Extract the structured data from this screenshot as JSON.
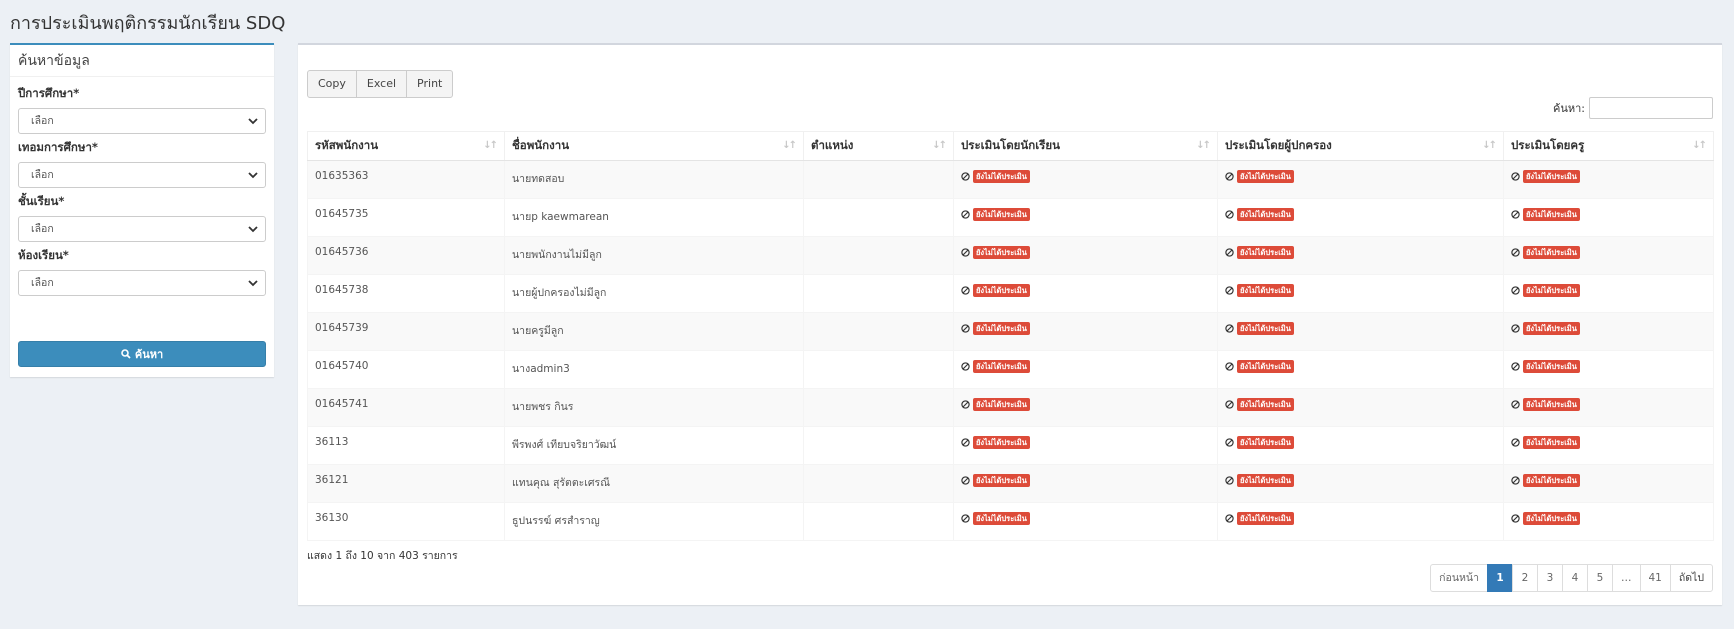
{
  "page": {
    "title": "การประเมินพฤติกรรมนักเรียน SDQ"
  },
  "search": {
    "title": "ค้นหาข้อมูล",
    "fields": [
      {
        "label": "ปีการศึกษา*",
        "value": "เลือก"
      },
      {
        "label": "เทอมการศึกษา*",
        "value": "เลือก"
      },
      {
        "label": "ชั้นเรียน*",
        "value": "เลือก"
      },
      {
        "label": "ห้องเรียน*",
        "value": "เลือก"
      }
    ],
    "button_label": "ค้นหา"
  },
  "toolbar": {
    "copy": "Copy",
    "excel": "Excel",
    "print": "Print"
  },
  "filter": {
    "label": "ค้นหา:"
  },
  "table": {
    "columns": [
      "รหัสพนักงาน",
      "ชื่อพนักงาน",
      "ตำแหน่ง",
      "ประเมินโดยนักเรียน",
      "ประเมินโดยผู้ปกครอง",
      "ประเมินโดยครู"
    ],
    "status_text": "ยังไม่ได้ประเมิน",
    "rows": [
      {
        "id": "01635363",
        "name": "นายทดสอบ",
        "position": ""
      },
      {
        "id": "01645735",
        "name": "นายp kaewmarean",
        "position": ""
      },
      {
        "id": "01645736",
        "name": "นายพนักงานไม่มีลูก",
        "position": ""
      },
      {
        "id": "01645738",
        "name": "นายผู้ปกครองไม่มีลูก",
        "position": ""
      },
      {
        "id": "01645739",
        "name": "นายครูมีลูก",
        "position": ""
      },
      {
        "id": "01645740",
        "name": "นางadmin3",
        "position": ""
      },
      {
        "id": "01645741",
        "name": "นายพชร กินร",
        "position": ""
      },
      {
        "id": "36113",
        "name": "พีรพงศ์ เทียบจริยาวัฒน์",
        "position": ""
      },
      {
        "id": "36121",
        "name": "แทนคุณ สุรัตตะเศรณี",
        "position": ""
      },
      {
        "id": "36130",
        "name": "ธูปนรรฆ์ ศรสำราญ",
        "position": ""
      }
    ]
  },
  "info": "แสดง 1 ถึง 10 จาก 403 รายการ",
  "pagination": {
    "prev": "ก่อนหน้า",
    "pages": [
      "1",
      "2",
      "3",
      "4",
      "5",
      "…",
      "41"
    ],
    "next": "ถัดไป",
    "active": "1"
  }
}
